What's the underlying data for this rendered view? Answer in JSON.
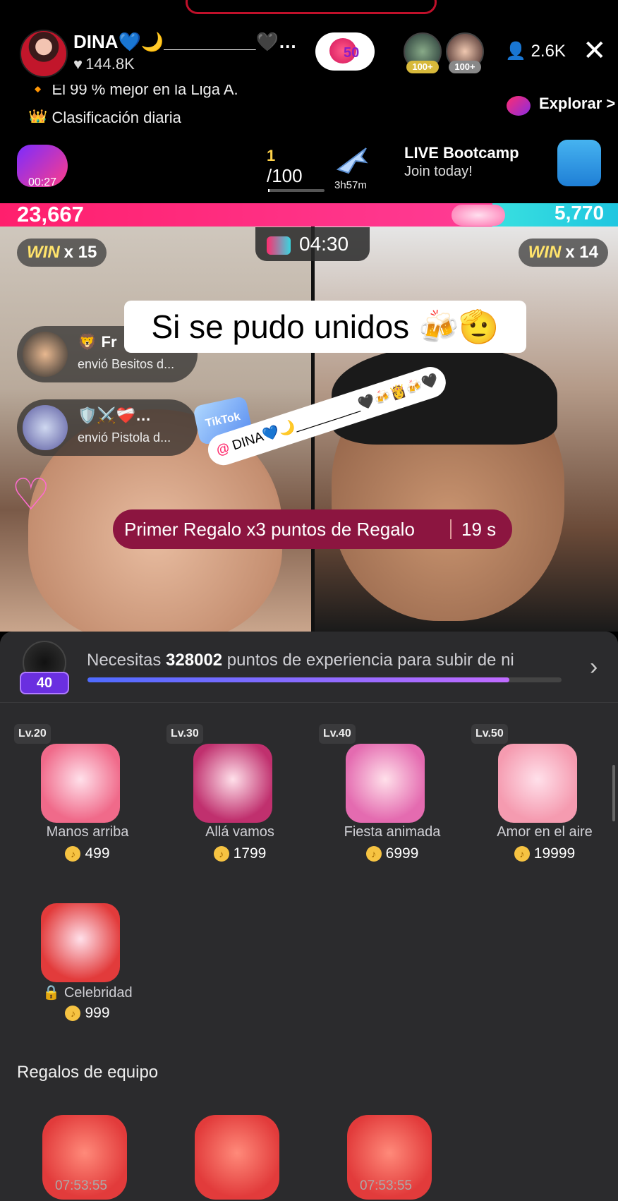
{
  "host": {
    "name": "DINA💙🌙_________🖤…",
    "likes": "144.8K"
  },
  "team_badge": {
    "level": "50"
  },
  "top_viewers": [
    {
      "badge": "100+"
    },
    {
      "badge": "100+"
    }
  ],
  "viewers_count": "2.6K",
  "ticker": {
    "line1": "🔸 El 99 % mejor en la Liga A.",
    "line2": "👑 Clasificación diaria"
  },
  "explore": {
    "label": "Explorar >"
  },
  "bolt": {
    "timer": "00:27"
  },
  "task": {
    "current": "1",
    "total": "/100",
    "timer": "3h57m"
  },
  "bootcamp": {
    "title": "LIVE Bootcamp",
    "subtitle": "Join today!"
  },
  "battle": {
    "score_left": "23,667",
    "score_right": "5,770",
    "win_label": "WIN",
    "left_win": "x 15",
    "right_win": "x 14",
    "timer": "04:30"
  },
  "caption": "Si se pudo unidos 🍻🫡",
  "notifications": [
    {
      "name": "🦁 Fr",
      "text": "envió  Besitos d..."
    },
    {
      "name": "🛡️⚔️❤️‍🩹…",
      "text": "envió  Pistola d..."
    }
  ],
  "sticker": {
    "tiktok": "TikTok"
  },
  "mention": {
    "at": "@",
    "text": "DINA💙🌙_________🖤🍻👸🍻🖤"
  },
  "promo": {
    "text": "Primer Regalo x3 puntos de Regalo",
    "seconds": "19 s"
  },
  "level": {
    "value": "40"
  },
  "xp": {
    "prefix": "Necesitas ",
    "points": "328002",
    "suffix": " puntos de experiencia para subir de ni",
    "progress": 0.89
  },
  "gifts": [
    {
      "level": "Lv.20",
      "name": "Manos arriba",
      "price": "499",
      "color": "#f06a8a"
    },
    {
      "level": "Lv.30",
      "name": "Allá vamos",
      "price": "1799",
      "color": "#c0306e"
    },
    {
      "level": "Lv.40",
      "name": "Fiesta animada",
      "price": "6999",
      "color": "#e46bb0"
    },
    {
      "level": "Lv.50",
      "name": "Amor en el aire",
      "price": "19999",
      "color": "#f59bb0"
    },
    {
      "level": "",
      "name": "🔒 Celebridad",
      "price": "999",
      "color": "#e23b3b"
    }
  ],
  "team_section": {
    "title": "Regalos de equipo",
    "timers": [
      "07:53:55",
      "",
      "07:53:55"
    ]
  }
}
